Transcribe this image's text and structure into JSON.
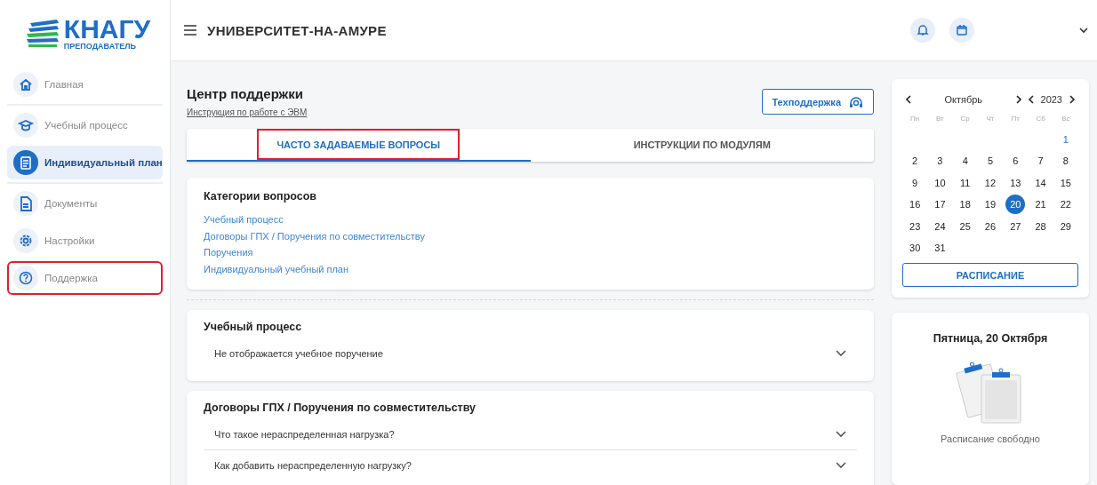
{
  "logo": {
    "title": "КНАГУ",
    "subtitle": "ПРЕПОДАВАТЕЛЬ"
  },
  "sidebar": {
    "items": [
      {
        "label": "Главная",
        "selected": false,
        "highlighted": false
      },
      {
        "label": "Учебный процесс",
        "selected": false,
        "highlighted": false
      },
      {
        "label": "Индивидуальный план",
        "selected": true,
        "highlighted": false
      },
      {
        "label": "Документы",
        "selected": false,
        "highlighted": false
      },
      {
        "label": "Настройки",
        "selected": false,
        "highlighted": false
      },
      {
        "label": "Поддержка",
        "selected": false,
        "highlighted": true
      }
    ]
  },
  "header": {
    "title": "УНИВЕРСИТЕТ-НА-АМУРЕ"
  },
  "page": {
    "title": "Центр поддержки",
    "link": "Инструкция по работе с ЭВМ",
    "support_button": "Техподдержка"
  },
  "tabs": [
    {
      "label": "ЧАСТО ЗАДАВАЕМЫЕ ВОПРОСЫ",
      "selected": true,
      "highlighted": true
    },
    {
      "label": "ИНСТРУКЦИИ ПО МОДУЛЯМ",
      "selected": false,
      "highlighted": false
    }
  ],
  "categories": {
    "title": "Категории вопросов",
    "links": [
      "Учебный процесс",
      "Договоры ГПХ / Поручения по совместительству",
      "Поручения",
      "Индивидуальный учебный план"
    ]
  },
  "sections": [
    {
      "title": "Учебный процесс",
      "questions": [
        {
          "text": "Не отображается учебное поручение",
          "expanded": false
        }
      ]
    },
    {
      "title": "Договоры ГПХ / Поручения по совместительству",
      "questions": [
        {
          "text": "Что такое нераспределенная нагрузка?",
          "expanded": false
        },
        {
          "text": "Как добавить нераспределенную нагрузку?",
          "expanded": false
        }
      ]
    }
  ],
  "calendar": {
    "month": "Октябрь",
    "year": "2023",
    "weekdays": [
      "Пн",
      "Вт",
      "Ср",
      "Чт",
      "Пт",
      "Сб",
      "Вс"
    ],
    "weeks": [
      [
        {
          "d": "1",
          "selected": false
        }
      ],
      [
        {
          "d": "2",
          "selected": false
        },
        {
          "d": "3",
          "selected": false
        },
        {
          "d": "4",
          "selected": false
        },
        {
          "d": "5",
          "selected": false
        },
        {
          "d": "6",
          "selected": false
        },
        {
          "d": "7",
          "selected": false
        },
        {
          "d": "8",
          "selected": false
        }
      ],
      [
        {
          "d": "9",
          "selected": false
        },
        {
          "d": "10",
          "selected": false
        },
        {
          "d": "11",
          "selected": false
        },
        {
          "d": "12",
          "selected": false
        },
        {
          "d": "13",
          "selected": false
        },
        {
          "d": "14",
          "selected": false
        },
        {
          "d": "15",
          "selected": false
        }
      ],
      [
        {
          "d": "16",
          "selected": false
        },
        {
          "d": "17",
          "selected": false
        },
        {
          "d": "18",
          "selected": false
        },
        {
          "d": "19",
          "selected": false
        },
        {
          "d": "20",
          "selected": true
        },
        {
          "d": "21",
          "selected": false
        },
        {
          "d": "22",
          "selected": false
        }
      ],
      [
        {
          "d": "23",
          "selected": false
        },
        {
          "d": "24",
          "selected": false
        },
        {
          "d": "25",
          "selected": false
        },
        {
          "d": "26",
          "selected": false
        },
        {
          "d": "27",
          "selected": false
        },
        {
          "d": "28",
          "selected": false
        },
        {
          "d": "29",
          "selected": false
        }
      ],
      [
        {
          "d": "30",
          "selected": false
        },
        {
          "d": "31",
          "selected": false
        }
      ]
    ],
    "button": "РАСПИСАНИЕ"
  },
  "schedule": {
    "date": "Пятница, 20 Октября",
    "empty_text": "Расписание свободно"
  }
}
